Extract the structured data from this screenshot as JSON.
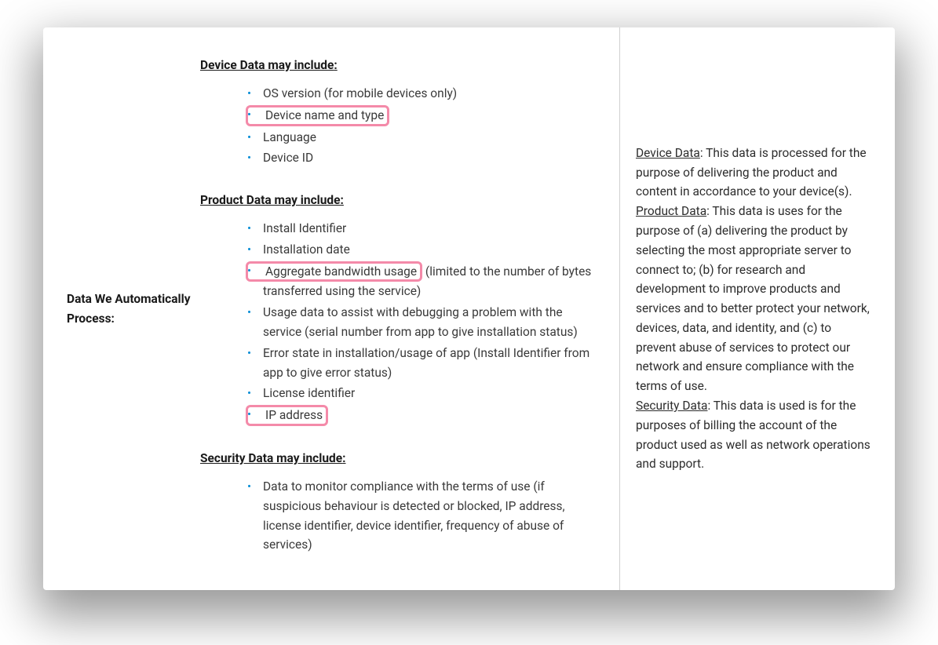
{
  "left": {
    "title": "Data We Automatically Process:"
  },
  "mid": {
    "device": {
      "heading": "Device Data may include",
      "items": [
        {
          "text": "OS version (for mobile devices only)",
          "hl": false
        },
        {
          "text": "Device name and type",
          "hl": true
        },
        {
          "text": "Language",
          "hl": false
        },
        {
          "text": "Device ID",
          "hl": false
        }
      ]
    },
    "product": {
      "heading": "Product Data may include",
      "items": [
        {
          "text": "Install Identifier",
          "hl": false
        },
        {
          "text": "Installation date",
          "hl": false
        },
        {
          "textA": "Aggregate bandwidth usage",
          "textB": " (limited to the number of bytes transferred using the service)",
          "hlA": true
        },
        {
          "text": "Usage data to assist with debugging a problem with the service (serial number from app to give installation status)",
          "hl": false
        },
        {
          "text": "Error state in installation/usage of app (Install Identifier from app to give error status)",
          "hl": false
        },
        {
          "text": "License identifier",
          "hl": false
        },
        {
          "text": "IP address",
          "hl": true
        }
      ]
    },
    "security": {
      "heading": "Security Data may include",
      "items": [
        {
          "text": "Data to monitor compliance with the terms of use (if suspicious behaviour is detected or blocked, IP address, license identifier, device identifier, frequency of abuse of services)",
          "hl": false
        }
      ]
    }
  },
  "right": {
    "device": {
      "label": "Device Data",
      "text": ": This data is processed for the purpose of delivering the product and content in accordance to your device(s)."
    },
    "product": {
      "label": "Product Data",
      "text": ": This data is uses for the purpose of (a) delivering the product by selecting the most appropriate server to connect to; (b) for research and development to improve products and services and to better protect your network, devices, data, and identity, and (c) to prevent abuse of services to protect our network and ensure compliance with the terms of use."
    },
    "security": {
      "label": "Security Data",
      "text": ": This data is used is for the purposes of billing the account of the product used as well as network operations and support."
    }
  }
}
